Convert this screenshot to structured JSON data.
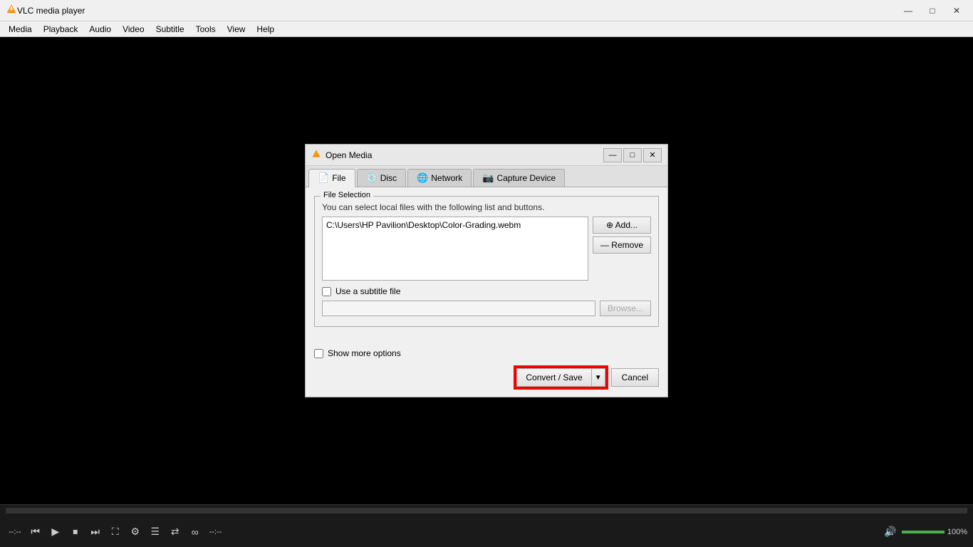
{
  "app": {
    "title": "VLC media player",
    "icon": "▶"
  },
  "menubar": {
    "items": [
      "Media",
      "Playback",
      "Audio",
      "Video",
      "Subtitle",
      "Tools",
      "View",
      "Help"
    ]
  },
  "bottom": {
    "time_left": "--:--",
    "time_right": "--:--",
    "volume_label": "100%"
  },
  "dialog": {
    "title": "Open Media",
    "tabs": [
      {
        "label": "File",
        "icon": "📄",
        "active": true
      },
      {
        "label": "Disc",
        "icon": "💿",
        "active": false
      },
      {
        "label": "Network",
        "icon": "🌐",
        "active": false
      },
      {
        "label": "Capture Device",
        "icon": "📷",
        "active": false
      }
    ],
    "file_selection": {
      "group_label": "File Selection",
      "description": "You can select local files with the following list and buttons.",
      "file_path": "C:\\Users\\HP Pavilion\\Desktop\\Color-Grading.webm",
      "add_button": "⊕ Add...",
      "remove_button": "— Remove"
    },
    "subtitle": {
      "checkbox_label": "Use a subtitle file",
      "checked": false,
      "path_placeholder": "",
      "browse_button": "Browse..."
    },
    "show_more": {
      "checked": false,
      "label": "Show more options"
    },
    "footer": {
      "convert_save": "Convert / Save",
      "dropdown_arrow": "▼",
      "cancel": "Cancel"
    }
  },
  "controls": {
    "play": "▶",
    "prev": "⏮",
    "stop": "⏹",
    "next": "⏭",
    "toggle_playlist": "☰",
    "extended": "⚙",
    "random": "⇄",
    "repeat": "↺",
    "loop": "∞",
    "volume_icon": "🔊"
  }
}
